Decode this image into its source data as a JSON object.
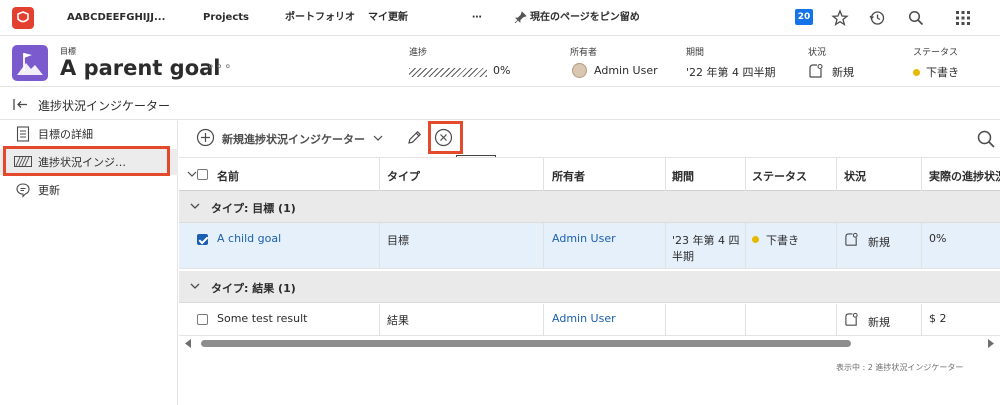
{
  "topnav": {
    "brand": "AABCDEEFGHIJJ...",
    "items": [
      "Projects",
      "ポートフォリオ",
      "マイ更新",
      "⋯"
    ],
    "pin_label": "現在のページをピン留め",
    "notification_count": "20"
  },
  "header": {
    "type_label": "目標",
    "title": "A parent goal",
    "more": "∘∘∘",
    "progress": {
      "label": "進捗",
      "value": "0%"
    },
    "owner": {
      "label": "所有者",
      "value": "Admin User"
    },
    "period": {
      "label": "期間",
      "value": "'22 年第 4 四半期"
    },
    "condition": {
      "label": "状況",
      "value": "新規"
    },
    "status": {
      "label": "ステータス",
      "value": "下書き",
      "color": "#e6b800"
    }
  },
  "subheader": {
    "title": "進捗状況インジケーター"
  },
  "sidebar": {
    "items": [
      {
        "label": "目標の詳細",
        "icon": "document-icon"
      },
      {
        "label": "進捗状況インジ…",
        "icon": "progress-bar-icon"
      },
      {
        "label": "更新",
        "icon": "chat-bubble-icon"
      }
    ]
  },
  "toolbar": {
    "add_label": "新規進捗状況インジケーター",
    "tooltip": "切断"
  },
  "table": {
    "columns": [
      "名前",
      "タイプ",
      "所有者",
      "期間",
      "ステータス",
      "状況",
      "実際の進捗状況"
    ],
    "groups": [
      {
        "label": "タイプ: 目標 (1)",
        "rows": [
          {
            "name": "A child goal",
            "type": "目標",
            "owner": "Admin User",
            "period_line1": "'23 年第 4 四",
            "period_line2": "半期",
            "status": "下書き",
            "condition": "新規",
            "actual": "0%",
            "checked": true
          }
        ]
      },
      {
        "label": "タイプ: 結果 (1)",
        "rows": [
          {
            "name": "Some test result",
            "type": "結果",
            "owner": "Admin User",
            "period_line1": "",
            "period_line2": "",
            "status": "",
            "condition": "新規",
            "actual": "$ 2",
            "checked": false
          }
        ]
      }
    ]
  },
  "footer": {
    "summary": "表示中 : 2 進捗状況インジケーター"
  },
  "colors": {
    "accent": "#1473e6",
    "highlight": "#e34a2b",
    "goal_tile": "#7a5acd",
    "link": "#1b5fb4"
  }
}
